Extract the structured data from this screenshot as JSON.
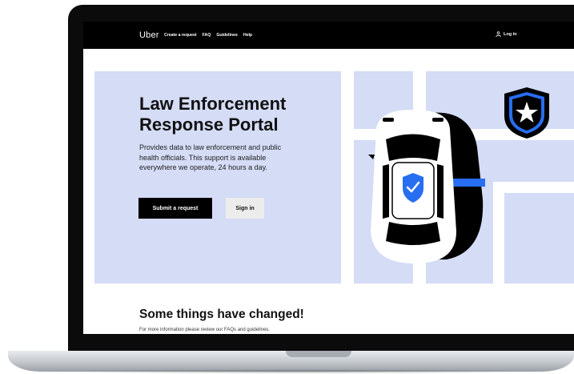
{
  "nav": {
    "logo": "Uber",
    "links": [
      "Create a request",
      "FAQ",
      "Guidelines",
      "Help"
    ],
    "login_label": "Log in"
  },
  "hero": {
    "title_line1": "Law Enforcement",
    "title_line2": "Response Portal",
    "description": "Provides data to law enforcement and public health officials. This support is available everywhere we operate, 24 hours a day.",
    "primary_button": "Submit a request",
    "secondary_button": "Sign in"
  },
  "section": {
    "title": "Some things have changed!",
    "subtitle": "For more information please review our FAQs and guidelines."
  },
  "colors": {
    "hero_bg": "#d4dcf6",
    "accent_blue": "#276ef1",
    "nav_bg": "#000000"
  },
  "icons": [
    "user-icon",
    "police-badge-icon",
    "shield-check-icon",
    "car-icon"
  ]
}
